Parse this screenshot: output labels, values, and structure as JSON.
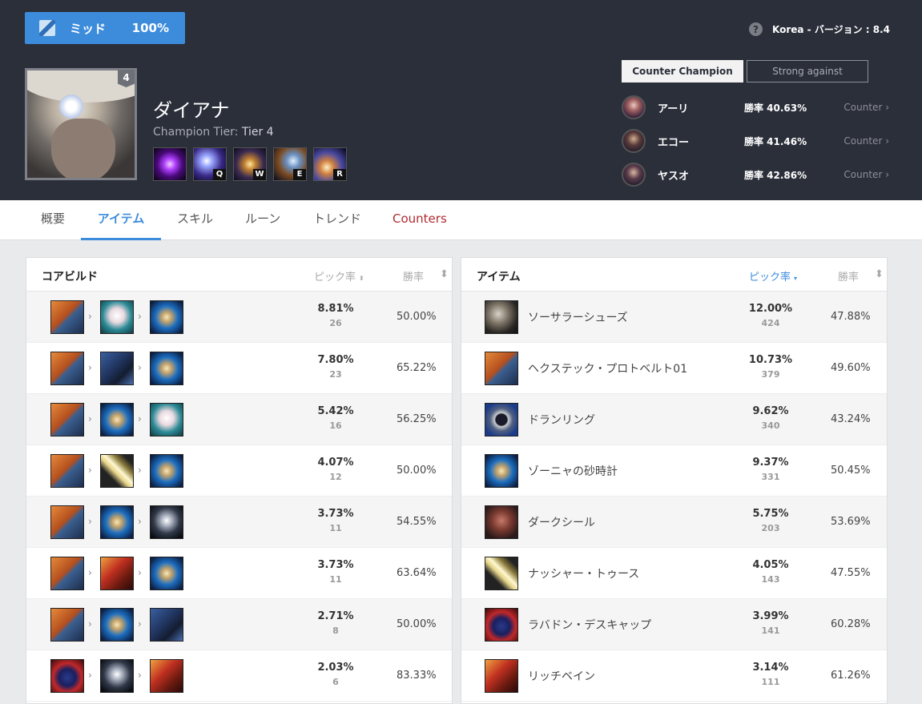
{
  "position": {
    "name": "ミッド",
    "rate": "100%",
    "icon": "mid-lane-icon"
  },
  "region": {
    "help_icon": "?",
    "text": "Korea - バージョン : 8.4"
  },
  "champion": {
    "name": "ダイアナ",
    "tier_label": "Champion Tier:",
    "tier_value": "Tier 4",
    "level": "4",
    "skills": [
      {
        "key": "",
        "icon": "passive-icon"
      },
      {
        "key": "Q",
        "icon": "q-skill-icon"
      },
      {
        "key": "W",
        "icon": "w-skill-icon"
      },
      {
        "key": "E",
        "icon": "e-skill-icon"
      },
      {
        "key": "R",
        "icon": "r-skill-icon"
      }
    ]
  },
  "counter_tabs": {
    "active": "Counter Champion",
    "inactive": "Strong against"
  },
  "counters": [
    {
      "name": "アーリ",
      "winrate": "勝率 40.63%",
      "link": "Counter ›"
    },
    {
      "name": "エコー",
      "winrate": "勝率 41.46%",
      "link": "Counter ›"
    },
    {
      "name": "ヤスオ",
      "winrate": "勝率 42.86%",
      "link": "Counter ›"
    }
  ],
  "nav": [
    "概要",
    "アイテム",
    "スキル",
    "ルーン",
    "トレンド",
    "Counters"
  ],
  "core_build": {
    "title": "コアビルド",
    "col_pick": "ピック率",
    "col_win": "勝率",
    "sort_icon": "⬍",
    "rows": [
      {
        "pct": "8.81%",
        "count": "26",
        "win": "50.00%"
      },
      {
        "pct": "7.80%",
        "count": "23",
        "win": "65.22%"
      },
      {
        "pct": "5.42%",
        "count": "16",
        "win": "56.25%"
      },
      {
        "pct": "4.07%",
        "count": "12",
        "win": "50.00%"
      },
      {
        "pct": "3.73%",
        "count": "11",
        "win": "54.55%"
      },
      {
        "pct": "3.73%",
        "count": "11",
        "win": "63.64%"
      },
      {
        "pct": "2.71%",
        "count": "8",
        "win": "50.00%"
      },
      {
        "pct": "2.03%",
        "count": "6",
        "win": "83.33%"
      }
    ]
  },
  "items": {
    "title": "アイテム",
    "col_pick": "ピック率",
    "col_win": "勝率",
    "sort_down": "▾",
    "sort_icon": "⬍",
    "rows": [
      {
        "name": "ソーサラーシューズ",
        "pct": "12.00%",
        "count": "424",
        "win": "47.88%"
      },
      {
        "name": "ヘクステック・プロトベルト01",
        "pct": "10.73%",
        "count": "379",
        "win": "49.60%"
      },
      {
        "name": "ドランリング",
        "pct": "9.62%",
        "count": "340",
        "win": "43.24%"
      },
      {
        "name": "ゾーニャの砂時計",
        "pct": "9.37%",
        "count": "331",
        "win": "50.45%"
      },
      {
        "name": "ダークシール",
        "pct": "5.75%",
        "count": "203",
        "win": "53.69%"
      },
      {
        "name": "ナッシャー・トゥース",
        "pct": "4.05%",
        "count": "143",
        "win": "47.55%"
      },
      {
        "name": "ラバドン・デスキャップ",
        "pct": "3.99%",
        "count": "141",
        "win": "60.28%"
      },
      {
        "name": "リッチベイン",
        "pct": "3.14%",
        "count": "111",
        "win": "61.26%"
      }
    ]
  }
}
